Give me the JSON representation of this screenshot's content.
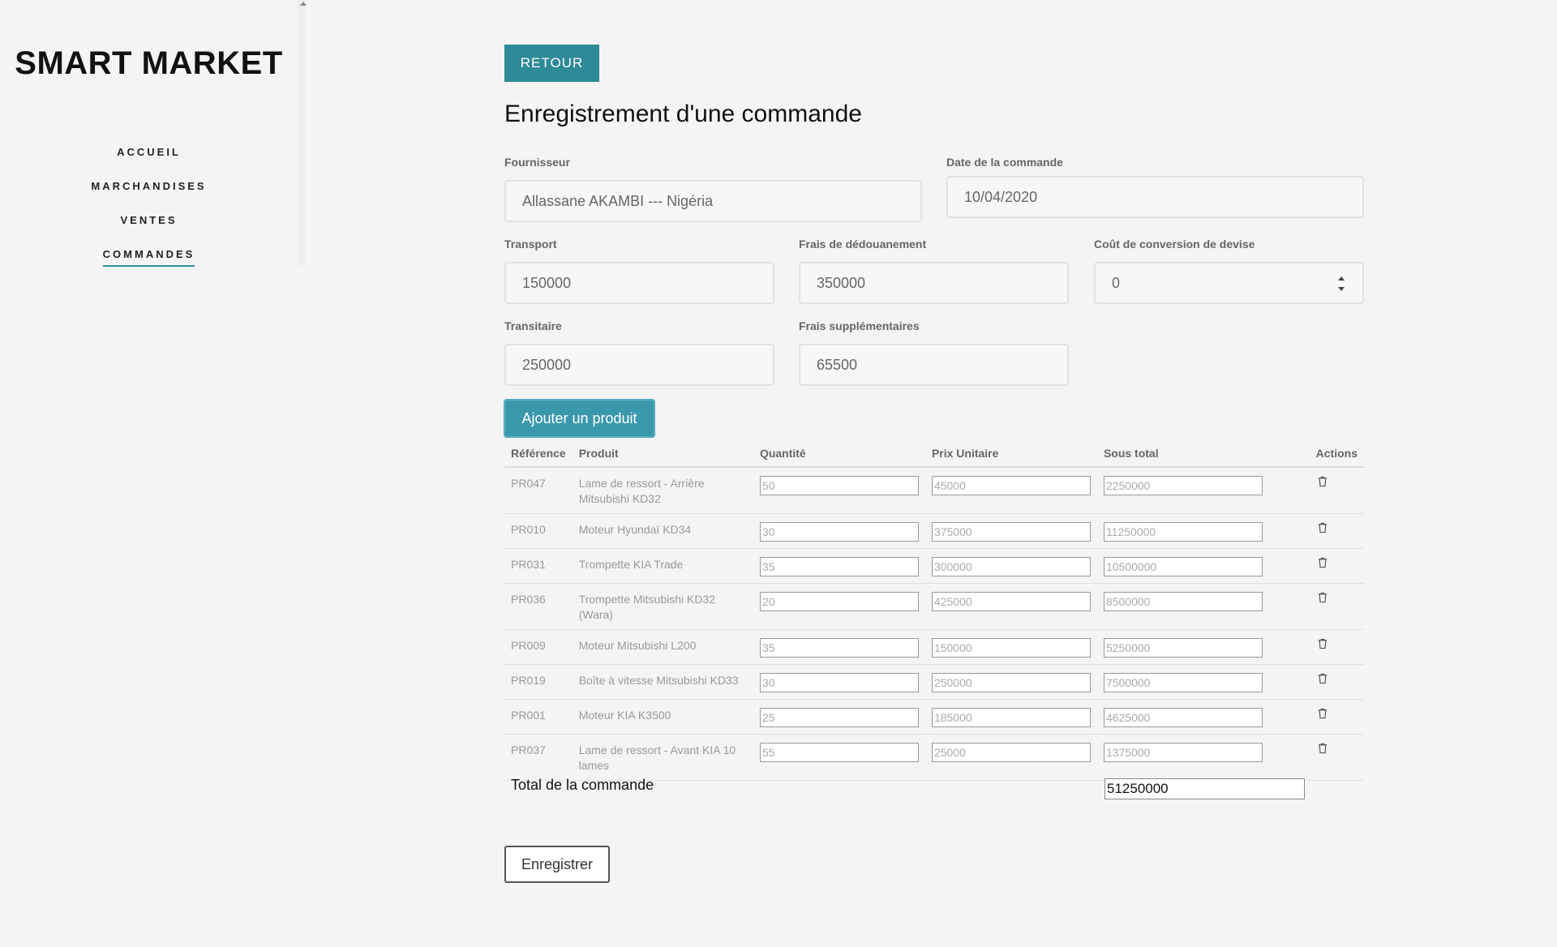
{
  "sidebar": {
    "brand": "SMART MARKET",
    "nav": [
      {
        "label": "ACCUEIL",
        "active": false
      },
      {
        "label": "MARCHANDISES",
        "active": false
      },
      {
        "label": "VENTES",
        "active": false
      },
      {
        "label": "COMMANDES",
        "active": true
      }
    ]
  },
  "header": {
    "back_label": "RETOUR",
    "title": "Enregistrement d'une commande"
  },
  "form": {
    "fournisseur": {
      "label": "Fournisseur",
      "value": "Allassane AKAMBI --- Nigéria"
    },
    "date": {
      "label": "Date de la commande",
      "value": "10/04/2020"
    },
    "transport": {
      "label": "Transport",
      "value": "150000"
    },
    "dedouanement": {
      "label": "Frais de dédouanement",
      "value": "350000"
    },
    "conversion": {
      "label": "Coût de conversion de devise",
      "value": "0"
    },
    "transitaire": {
      "label": "Transitaire",
      "value": "250000"
    },
    "supplementaires": {
      "label": "Frais supplémentaires",
      "value": "65500"
    }
  },
  "add_product_label": "Ajouter un produit",
  "table": {
    "headers": {
      "reference": "Référence",
      "produit": "Produit",
      "quantite": "Quantité",
      "prix": "Prix Unitaire",
      "sous_total": "Sous total",
      "actions": "Actions"
    },
    "rows": [
      {
        "ref": "PR047",
        "produit": "Lame de ressort - Arrière Mitsubishi KD32",
        "quantite": "50",
        "prix": "45000",
        "sous_total": "2250000"
      },
      {
        "ref": "PR010",
        "produit": "Moteur Hyundaï KD34",
        "quantite": "30",
        "prix": "375000",
        "sous_total": "11250000"
      },
      {
        "ref": "PR031",
        "produit": "Trompette KIA Trade",
        "quantite": "35",
        "prix": "300000",
        "sous_total": "10500000"
      },
      {
        "ref": "PR036",
        "produit": "Trompette Mitsubishi KD32 (Wara)",
        "quantite": "20",
        "prix": "425000",
        "sous_total": "8500000"
      },
      {
        "ref": "PR009",
        "produit": "Moteur Mitsubishi L200",
        "quantite": "35",
        "prix": "150000",
        "sous_total": "5250000"
      },
      {
        "ref": "PR019",
        "produit": "Boîte à vitesse Mitsubishi KD33",
        "quantite": "30",
        "prix": "250000",
        "sous_total": "7500000"
      },
      {
        "ref": "PR001",
        "produit": "Moteur KIA K3500",
        "quantite": "25",
        "prix": "185000",
        "sous_total": "4625000"
      },
      {
        "ref": "PR037",
        "produit": "Lame de ressort - Avant KIA 10 lames",
        "quantite": "55",
        "prix": "25000",
        "sous_total": "1375000"
      }
    ]
  },
  "total": {
    "label": "Total de la commande",
    "value": "51250000"
  },
  "save_label": "Enregistrer",
  "icons": {
    "delete": "trash-icon"
  },
  "colors": {
    "accent": "#2f8a97",
    "add_button": "#3a98ad",
    "background": "#f4f4f4"
  }
}
